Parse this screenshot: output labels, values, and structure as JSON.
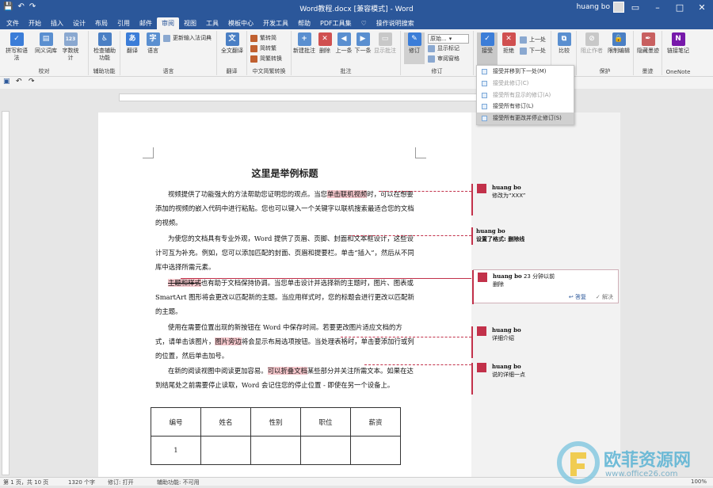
{
  "window": {
    "title": "Word教程.docx [兼容模式] - Word",
    "user": "huang bo",
    "qat": [
      "💾",
      "↶",
      "↷"
    ]
  },
  "tabs": [
    "文件",
    "开始",
    "插入",
    "设计",
    "布局",
    "引用",
    "邮件",
    "审阅",
    "视图",
    "工具",
    "模板中心",
    "开发工具",
    "帮助",
    "PDF工具集",
    "♡",
    "操作说明搜索"
  ],
  "ribbon": {
    "groups": {
      "proofing": {
        "label": "校对",
        "spell": "拼写和语法",
        "thesaurus": "同义词库",
        "wordcount": "字数统计"
      },
      "accessibility": {
        "label": "辅助功能",
        "check": "检查辅助功能"
      },
      "language": {
        "label": "语言",
        "translate": "翻译",
        "lang": "语言",
        "update": "更新输入法词典"
      },
      "chinese": {
        "label": "中文简繁转换",
        "fanjian": "繁转简",
        "jianfan": "简转繁",
        "convert": "简繁转换",
        "full": "全文翻译"
      },
      "comments": {
        "label": "批注",
        "new": "新建批注",
        "delete": "删除",
        "prev": "上一条",
        "next": "下一条",
        "show": "显示批注"
      },
      "tracking": {
        "label": "修订",
        "track": "修订",
        "mode": "原始...",
        "show_markup": "显示标记",
        "pane": "审阅窗格"
      },
      "changes": {
        "label": "",
        "accept": "接受",
        "reject": "拒绝",
        "prev": "上一处",
        "next": "下一处"
      },
      "compare": {
        "label": "",
        "compare": "比较"
      },
      "protect": {
        "label": "保护",
        "block": "阻止作者",
        "restrict": "限制编辑"
      },
      "ink": {
        "label": "墨迹",
        "hide": "隐藏墨迹"
      },
      "onenote": {
        "label": "OneNote",
        "link": "链接笔记"
      }
    }
  },
  "dropdown": {
    "items": [
      {
        "label": "接受并移到下一处(M)",
        "disabled": false,
        "selected": false
      },
      {
        "label": "接受此修订(C)",
        "disabled": true,
        "selected": false
      },
      {
        "label": "接受所有显示的修订(A)",
        "disabled": true,
        "selected": false
      },
      {
        "label": "接受所有修订(L)",
        "disabled": false,
        "selected": false
      },
      {
        "label": "接受所有更改并停止修订(S)",
        "disabled": false,
        "selected": true
      }
    ]
  },
  "document": {
    "title": "这里是举例标题",
    "p1a": "视频提供了功能强大的方法帮助您证明您的观点。当您",
    "p1hl": "单击联机视频",
    "p1b": "时，可以在想要添加的视频的嵌入代码中进行粘贴。您也可以键入一个关键字以联机搜索最适合您的文档的视频。",
    "p2": "为使您的文档具有专业外观，Word 提供了页眉、页脚、封面和文本框设计，这些设计可互为补充。例如，您可以添加匹配的封面、页眉和提要栏。单击“插入”，然后从不同库中选择所需元素。",
    "p3hl": "主题和样式",
    "p3": "也有助于文档保持协调。当您单击设计并选择新的主题时，图片、图表或 SmartArt 图形将会更改以匹配新的主题。当应用样式时，您的标题会进行更改以匹配新的主题。",
    "p4a": "使用在需要位置出现的新按钮在 Word 中保存时间。若要更改图片适应文档的方式，请单击该图片，",
    "p4hl": "图片旁边",
    "p4b": "将会显示布局选项按钮。当处理表格时，单击要添加行或列的位置，然后单击加号。",
    "p5a": "在新的阅读视图中阅读更加容易。",
    "p5hl": "可以折叠文档",
    "p5b": "某些部分并关注所需文本。如果在达到结尾处之前需要停止读取，Word 会记住您的停止位置 - 即使在另一个设备上。",
    "table": {
      "headers": [
        "编号",
        "姓名",
        "性别",
        "职位",
        "薪资"
      ],
      "row1": [
        "1",
        "",
        "",
        "",
        ""
      ]
    }
  },
  "comments": [
    {
      "author": "huang bo",
      "time": "",
      "text": "修改为“XXX”"
    },
    {
      "author": "huang bo",
      "time": "",
      "text": "设置了格式: 删除线"
    },
    {
      "author": "huang bo",
      "time": "23 分钟以前",
      "text": "删除",
      "reply": "答复",
      "resolve": "解决"
    },
    {
      "author": "huang bo",
      "time": "",
      "text": "详细介绍"
    },
    {
      "author": "huang bo",
      "time": "",
      "text": "说的详细一点"
    }
  ],
  "status": {
    "page": "第 1 页，共 10 页",
    "words": "1320 个字",
    "track": "修订: 打开",
    "access": "辅助功能: 不可用",
    "zoom": "100%"
  },
  "watermark": {
    "cn": "欧菲资源网",
    "url": "www.office26.com"
  },
  "colors": {
    "brand": "#2b579a",
    "comment": "#c2314a",
    "highlight": "#f5c7cc"
  }
}
